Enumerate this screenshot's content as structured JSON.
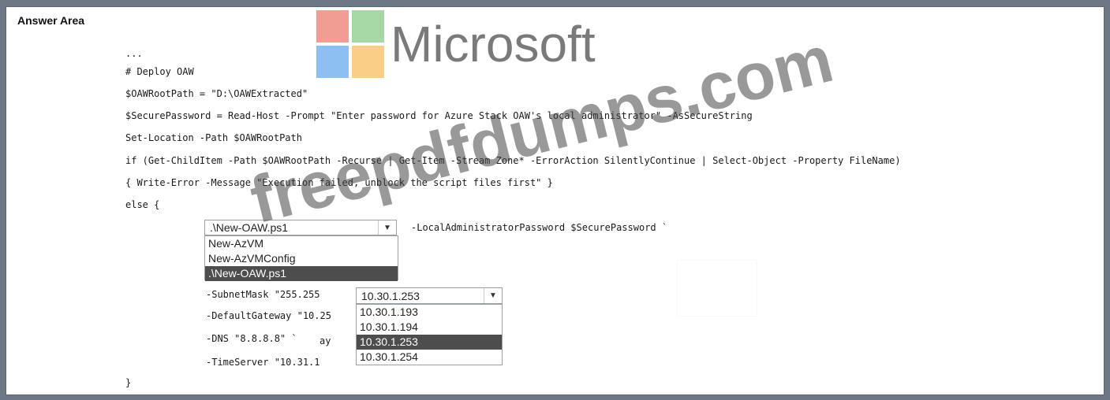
{
  "answer_area": {
    "title": "Answer Area"
  },
  "logo": {
    "text": "Microsoft",
    "colors": [
      "#e74c3c",
      "#5cb85c",
      "#2f8be8",
      "#f5a623"
    ]
  },
  "watermark": {
    "text": "freepdfdumps.com"
  },
  "code": {
    "line1": "...",
    "line2": "# Deploy OAW",
    "line3": "$OAWRootPath = \"D:\\OAWExtracted\"",
    "line4": "$SecurePassword = Read-Host -Prompt \"Enter password for Azure Stack OAW's local administrator\" -AsSecureString",
    "line5": "Set-Location -Path $OAWRootPath",
    "line6": "if (Get-ChildItem -Path $OAWRootPath -Recurse | Get-Item -Stream Zone* -ErrorAction SilentlyContinue | Select-Object -Property FileName)",
    "line7": "{ Write-Error -Message \"Execution failed, unblock the script files first\" }",
    "line8": "else {",
    "after_dropdown1": "-LocalAdministratorPassword $SecurePassword `",
    "subnet": "-SubnetMask \"255.255",
    "gateway": "-DefaultGateway \"10.25",
    "dns": "-DNS \"8.8.8.8\" `",
    "dns_partial": "ay",
    "timeserver": "-TimeServer \"10.31.1",
    "closing": "}"
  },
  "dropdown1": {
    "selected": ".\\New-OAW.ps1",
    "options": [
      "New-AzVM",
      "New-AzVMConfig",
      ".\\New-OAW.ps1"
    ]
  },
  "dropdown2": {
    "selected": "10.30.1.253",
    "options": [
      "10.30.1.193",
      "10.30.1.194",
      "10.30.1.253",
      "10.30.1.254"
    ]
  }
}
